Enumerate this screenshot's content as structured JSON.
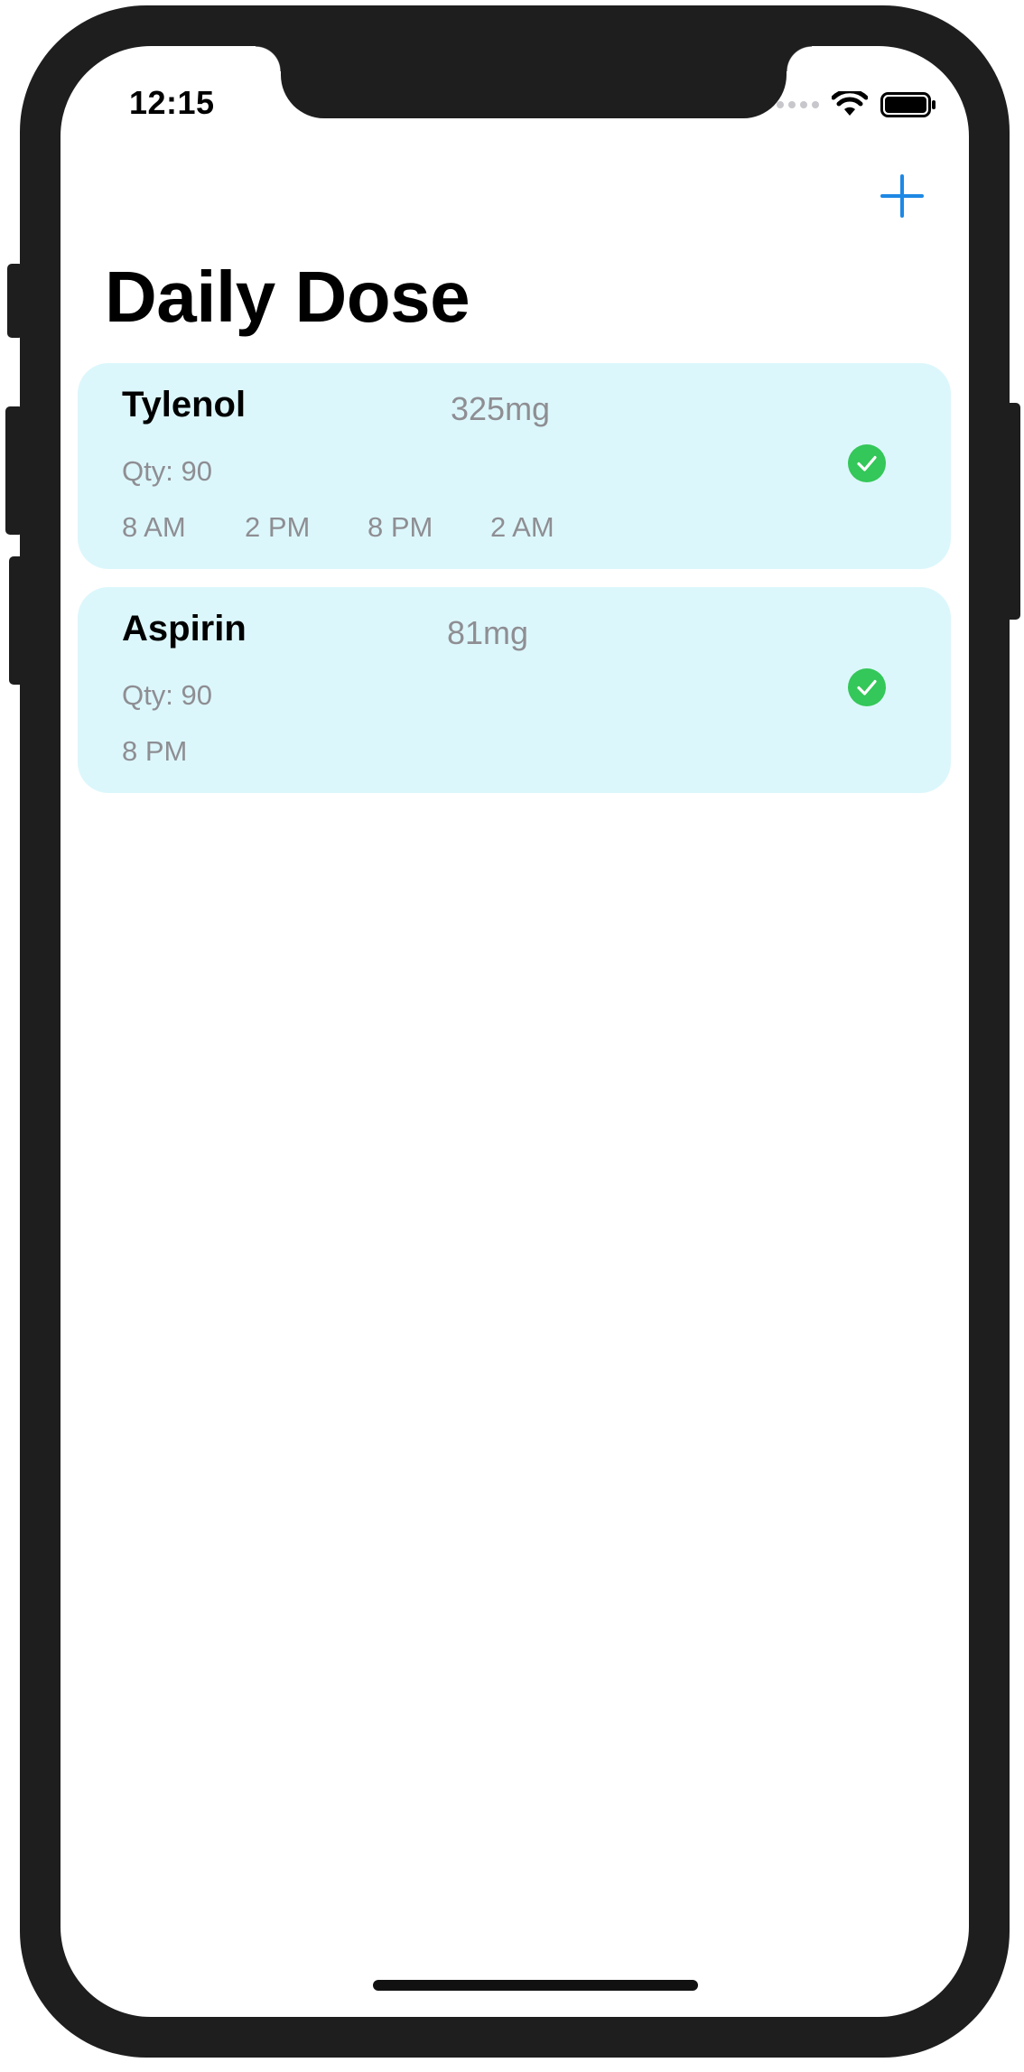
{
  "status_bar": {
    "time": "12:15",
    "icons": [
      "signal-dots-icon",
      "wifi-icon",
      "battery-icon"
    ]
  },
  "nav": {
    "add_icon": "plus-icon",
    "title": "Daily Dose"
  },
  "colors": {
    "accent": "#1e88e5",
    "card_background": "#dcf7fb",
    "taken_green": "#34c759",
    "secondary_text": "#8e8e93"
  },
  "medications": [
    {
      "name": "Tylenol",
      "dose": "325mg",
      "quantity": "Qty: 90",
      "times": [
        "8 AM",
        "2 PM",
        "8 PM",
        "2 AM"
      ],
      "status_icon": "checkmark-circle-icon"
    },
    {
      "name": "Aspirin",
      "dose": "81mg",
      "quantity": "Qty: 90",
      "times": [
        "8 PM"
      ],
      "status_icon": "checkmark-circle-icon"
    }
  ]
}
